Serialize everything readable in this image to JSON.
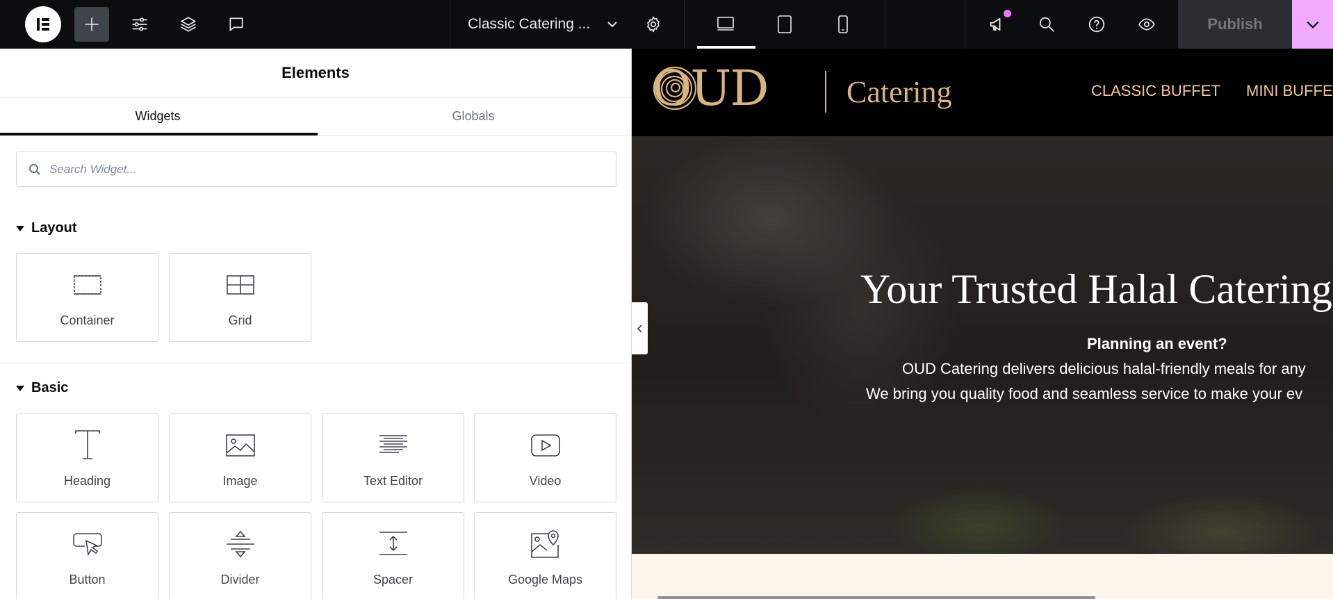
{
  "topbar": {
    "document_title": "Classic Catering ...",
    "publish_label": "Publish",
    "colors": {
      "background": "#0c0d0e",
      "accent": "#f0abfc",
      "notification": "#e879f9"
    }
  },
  "panel": {
    "title": "Elements",
    "tabs": [
      {
        "label": "Widgets",
        "active": true
      },
      {
        "label": "Globals",
        "active": false
      }
    ],
    "search": {
      "placeholder": "Search Widget..."
    },
    "categories": [
      {
        "name": "Layout",
        "widgets": [
          {
            "label": "Container",
            "icon": "container-icon"
          },
          {
            "label": "Grid",
            "icon": "grid-icon"
          }
        ]
      },
      {
        "name": "Basic",
        "widgets": [
          {
            "label": "Heading",
            "icon": "heading-icon"
          },
          {
            "label": "Image",
            "icon": "image-icon"
          },
          {
            "label": "Text Editor",
            "icon": "text-editor-icon"
          },
          {
            "label": "Video",
            "icon": "video-icon"
          },
          {
            "label": "Button",
            "icon": "button-icon"
          },
          {
            "label": "Divider",
            "icon": "divider-icon"
          },
          {
            "label": "Spacer",
            "icon": "spacer-icon"
          },
          {
            "label": "Google Maps",
            "icon": "google-maps-icon"
          }
        ]
      }
    ]
  },
  "preview": {
    "brand": {
      "name": "OUD",
      "tagline": "Catering"
    },
    "nav": [
      "CLASSIC BUFFET",
      "MINI BUFFET"
    ],
    "hero": {
      "title": "Your Trusted Halal Catering",
      "subtitle": "Planning an event?",
      "line1": "OUD Catering delivers delicious halal-friendly meals for any",
      "line2": "We bring you quality food and seamless service to make your ev"
    },
    "colors": {
      "gold": "#d9b47f",
      "nav": "#f5c98e",
      "cream": "#fdf5ec"
    }
  }
}
